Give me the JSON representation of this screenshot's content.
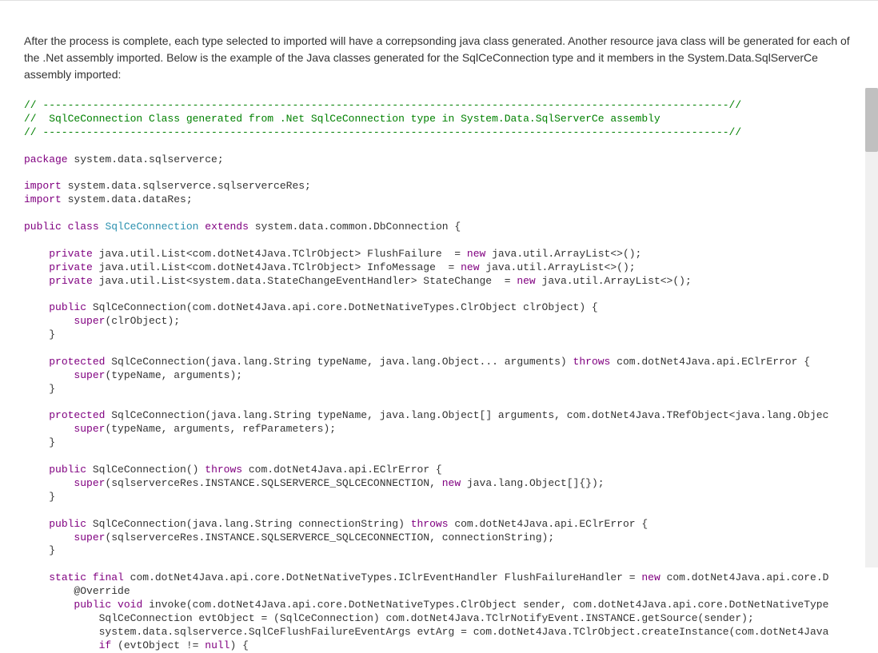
{
  "description": "After the process is complete, each type selected to imported will have a correpsonding java class generated. Another resource java class will be generated for each of the .Net assembly imported. Below is the example of the Java classes generated for the SqlCeConnection type and it members in the System.Data.SqlServerCe assembly imported:",
  "code": {
    "line1": "// --------------------------------------------------------------------------------------------------------------//",
    "line2": "//  SqlCeConnection Class generated from .Net SqlCeConnection type in System.Data.SqlServerCe assembly",
    "line3": "// --------------------------------------------------------------------------------------------------------------//",
    "kw_package": "package",
    "pkg_name": " system.data.sqlserverce;",
    "kw_import": "import",
    "imp1": " system.data.sqlserverce.sqlserverceRes;",
    "imp2": " system.data.dataRes;",
    "kw_public": "public",
    "kw_class": "class",
    "kw_extends": "extends",
    "kw_private": "private",
    "kw_protected": "protected",
    "kw_new": "new",
    "kw_super": "super",
    "kw_throws": "throws",
    "kw_static": "static",
    "kw_final": "final",
    "kw_void": "void",
    "kw_if": "if",
    "kw_null": "null",
    "cls_SqlCeConnection": "SqlCeConnection",
    "cls_DbConnection": "system.data.common.DbConnection",
    "txt_sp": " ",
    "txt_openbrace": " {",
    "txt_closebrace": "}",
    "field1_type": " java.util.List<com.dotNet4Java.TClrObject> FlushFailure  = ",
    "field1_init": " java.util.ArrayList<>();",
    "field2_type": " java.util.List<com.dotNet4Java.TClrObject> InfoMessage  = ",
    "field2_init": " java.util.ArrayList<>();",
    "field3_type": " java.util.List<system.data.StateChangeEventHandler> StateChange  = ",
    "field3_init": " java.util.ArrayList<>();",
    "ctor1_sig": " SqlCeConnection(com.dotNet4Java.api.core.DotNetNativeTypes.ClrObject clrObject) {",
    "ctor1_body": "(clrObject);",
    "ctor2_sig": " SqlCeConnection(java.lang.String typeName, java.lang.Object... arguments) ",
    "ctor2_throws": " com.dotNet4Java.api.EClrError {",
    "ctor2_body": "(typeName, arguments);",
    "ctor3_sig": " SqlCeConnection(java.lang.String typeName, java.lang.Object[] arguments, com.dotNet4Java.TRefObject<java.lang.Objec",
    "ctor3_body": "(typeName, arguments, refParameters);",
    "ctor4_sig": " SqlCeConnection() ",
    "ctor4_throws": " com.dotNet4Java.api.EClrError {",
    "ctor4_body1": "(sqlserverceRes.INSTANCE.SQLSERVERCE_SQLCECONNECTION, ",
    "ctor4_body2": " java.lang.Object[]{});",
    "ctor5_sig": " SqlCeConnection(java.lang.String connectionString) ",
    "ctor5_throws": " com.dotNet4Java.api.EClrError {",
    "ctor5_body": "(sqlserverceRes.INSTANCE.SQLSERVERCE_SQLCECONNECTION, connectionString);",
    "handler_sig": " com.dotNet4Java.api.core.DotNetNativeTypes.IClrEventHandler FlushFailureHandler = ",
    "handler_init": " com.dotNet4Java.api.core.D",
    "override": "        @Override",
    "invoke_sig": " invoke(com.dotNet4Java.api.core.DotNetNativeTypes.ClrObject sender, com.dotNet4Java.api.core.DotNetNativeType",
    "invoke_body1": "            SqlCeConnection evtObject = (SqlCeConnection) com.dotNet4Java.TClrNotifyEvent.INSTANCE.getSource(sender);",
    "invoke_body2": "            system.data.sqlserverce.SqlCeFlushFailureEventArgs evtArg = com.dotNet4Java.TClrObject.createInstance(com.dotNet4Java",
    "if_cond": " (evtObject != ",
    "if_end": ") {"
  }
}
